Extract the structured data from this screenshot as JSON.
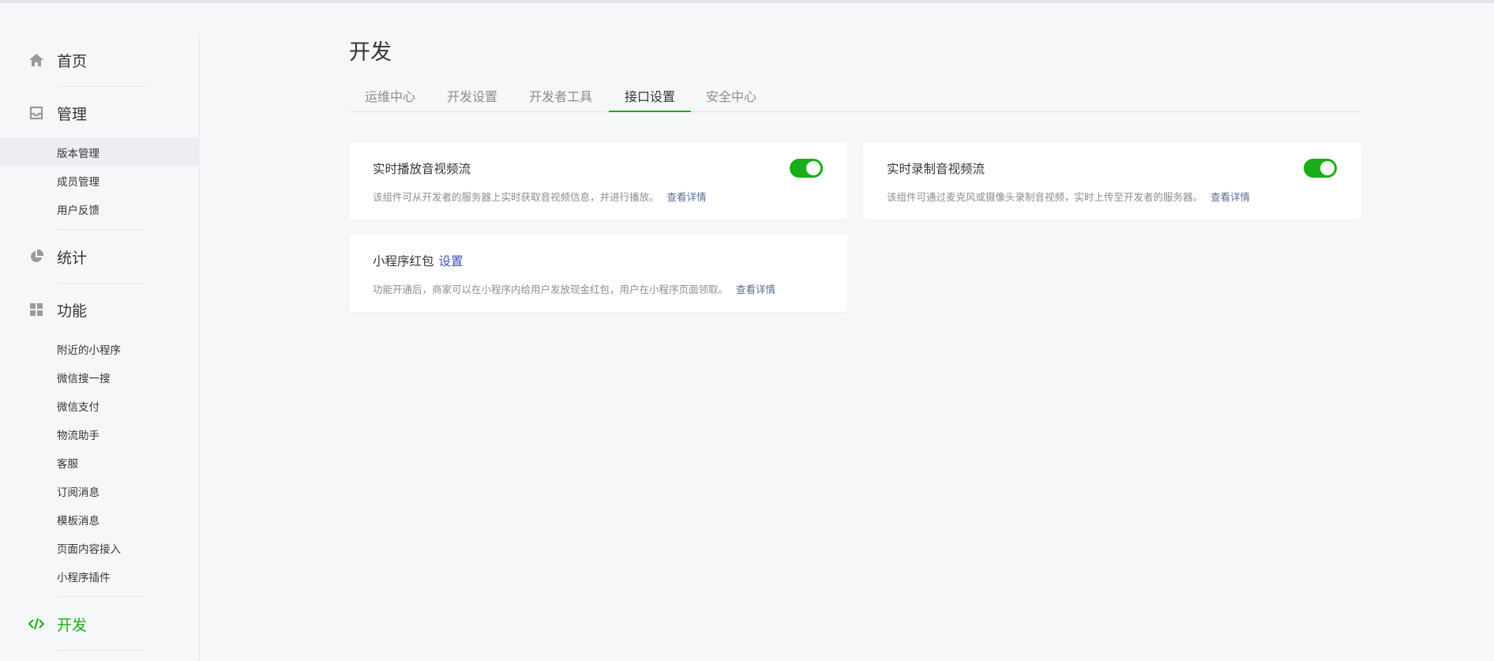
{
  "sidebar": {
    "home": {
      "label": "首页",
      "icon": "home-icon"
    },
    "manage": {
      "label": "管理",
      "icon": "inbox-icon",
      "items": [
        "版本管理",
        "成员管理",
        "用户反馈"
      ]
    },
    "stats": {
      "label": "统计",
      "icon": "pie-chart-icon"
    },
    "features": {
      "label": "功能",
      "icon": "grid-icon",
      "items": [
        "附近的小程序",
        "微信搜一搜",
        "微信支付",
        "物流助手",
        "客服",
        "订阅消息",
        "模板消息",
        "页面内容接入",
        "小程序插件"
      ]
    },
    "develop": {
      "label": "开发",
      "icon": "code-icon"
    }
  },
  "page": {
    "title": "开发"
  },
  "tabs": [
    "运维中心",
    "开发设置",
    "开发者工具",
    "接口设置",
    "安全中心"
  ],
  "active_tab": "接口设置",
  "cards": [
    {
      "title": "实时播放音视频流",
      "desc": "该组件可从开发者的服务器上实时获取音视频信息，并进行播放。",
      "link": "查看详情",
      "enabled": true
    },
    {
      "title": "实时录制音视频流",
      "desc": "该组件可通过麦克风或摄像头录制音视频，实时上传至开发者的服务器。",
      "link": "查看详情",
      "enabled": true
    },
    {
      "title": "小程序红包",
      "title_link": "设置",
      "desc": "功能开通后，商家可以在小程序内给用户发放现金红包，用户在小程序页面领取。",
      "link": "查看详情"
    }
  ],
  "colors": {
    "accent": "#1aad19",
    "link": "#576b95",
    "text": "#353535",
    "muted": "#8d8d8d"
  }
}
